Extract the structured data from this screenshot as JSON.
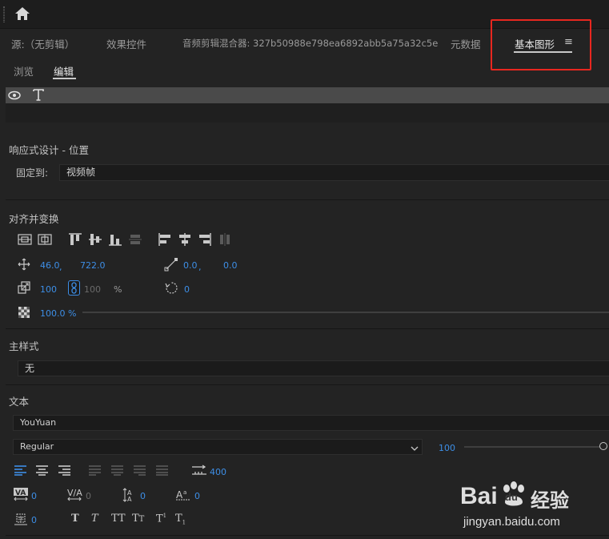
{
  "panel_tabs": [
    {
      "label": "源:（无剪辑）",
      "active": false
    },
    {
      "label": "效果控件",
      "active": false
    },
    {
      "label": "音频剪辑混合器: 327b50988e798ea6892abb5a75a32c5e",
      "active": false
    },
    {
      "label": "元数据",
      "active": false
    },
    {
      "label": "基本图形",
      "active": true
    }
  ],
  "menu_icon": "≡",
  "sub_tabs": [
    {
      "label": "浏览",
      "active": false
    },
    {
      "label": "编辑",
      "active": true
    }
  ],
  "responsive": {
    "title": "响应式设计 - 位置",
    "pin_label": "固定到:",
    "pin_value": "视频帧"
  },
  "align": {
    "title": "对齐并变换",
    "position_x": "46.0",
    "position_sep": ",",
    "position_y": "722.0",
    "anchor_x": "0.0",
    "anchor_sep": ",",
    "anchor_y": "0.0",
    "scale": "100",
    "scale_linked": "100",
    "scale_unit": "%",
    "rotation": "0",
    "opacity": "100.0 %"
  },
  "master_style": {
    "title": "主样式",
    "value": "无"
  },
  "text": {
    "title": "文本",
    "font": "YouYuan",
    "style": "Regular",
    "size": "100",
    "size_slider_fraction": 1.0,
    "tab_width": "400",
    "kerning": "0",
    "tracking": "0",
    "leading": "0",
    "baseline": "0",
    "tsume": "0"
  },
  "watermark": {
    "brand_a": "Bai",
    "brand_b": "du",
    "brand_c": "经验",
    "url": "jingyan.baidu.com"
  },
  "colors": {
    "accent_blue": "#3d8ee6",
    "highlight_red": "#e8271f",
    "panel_bg": "#232323"
  }
}
